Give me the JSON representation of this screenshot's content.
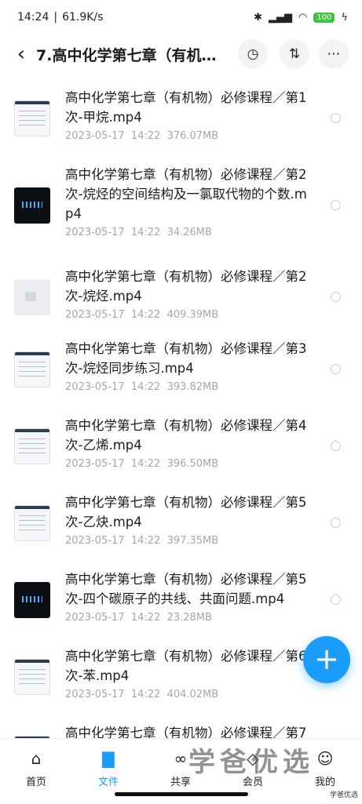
{
  "status_bar": {
    "time": "14:24",
    "speed": "61.9K/s",
    "battery": "100"
  },
  "header": {
    "back_icon": "chevron-left-icon",
    "title": "7.高中化学第七章（有机...",
    "history_icon": "history-icon",
    "sort_icon": "sort-icon",
    "more_icon": "more-icon"
  },
  "files": [
    {
      "name": "高中化学第七章（有机物）必修课程／第1次-甲烷.mp4",
      "date": "2023-05-17",
      "time": "14:22",
      "size": "376.07MB",
      "thumb": "doc"
    },
    {
      "name": "高中化学第七章（有机物）必修课程／第2次-烷烃的空间结构及一氯取代物的个数.mp4",
      "date": "2023-05-17",
      "time": "14:22",
      "size": "34.26MB",
      "thumb": "dark"
    },
    {
      "name": "高中化学第七章（有机物）必修课程／第2次-烷烃.mp4",
      "date": "2023-05-17",
      "time": "14:22",
      "size": "409.39MB",
      "thumb": "blank"
    },
    {
      "name": "高中化学第七章（有机物）必修课程／第3次-烷烃同步练习.mp4",
      "date": "2023-05-17",
      "time": "14:22",
      "size": "393.82MB",
      "thumb": "doc"
    },
    {
      "name": "高中化学第七章（有机物）必修课程／第4次-乙烯.mp4",
      "date": "2023-05-17",
      "time": "14:22",
      "size": "396.50MB",
      "thumb": "doc"
    },
    {
      "name": "高中化学第七章（有机物）必修课程／第5次-乙炔.mp4",
      "date": "2023-05-17",
      "time": "14:22",
      "size": "397.35MB",
      "thumb": "doc"
    },
    {
      "name": "高中化学第七章（有机物）必修课程／第5次-四个碳原子的共线、共面问题.mp4",
      "date": "2023-05-17",
      "time": "14:22",
      "size": "23.28MB",
      "thumb": "dark"
    },
    {
      "name": "高中化学第七章（有机物）必修课程／第6次-苯.mp4",
      "date": "2023-05-17",
      "time": "14:22",
      "size": "404.02MB",
      "thumb": "doc"
    },
    {
      "name": "高中化学第七章（有机物）必修课程／第7",
      "date": "",
      "time": "",
      "size": "",
      "thumb": "doc"
    }
  ],
  "fab": {
    "label": "+",
    "icon": "plus-icon"
  },
  "tabs": [
    {
      "label": "首页",
      "icon": "home-icon",
      "active": false
    },
    {
      "label": "文件",
      "icon": "folder-icon",
      "active": true
    },
    {
      "label": "共享",
      "icon": "share-icon",
      "active": false
    },
    {
      "label": "会员",
      "icon": "member-icon",
      "active": false
    },
    {
      "label": "我的",
      "icon": "profile-icon",
      "active": false
    }
  ],
  "watermark": {
    "text": "学爸优选",
    "corner_text": "学爸优选"
  },
  "colors": {
    "accent": "#1a9dfc",
    "meta_text": "#a2a7ae"
  }
}
